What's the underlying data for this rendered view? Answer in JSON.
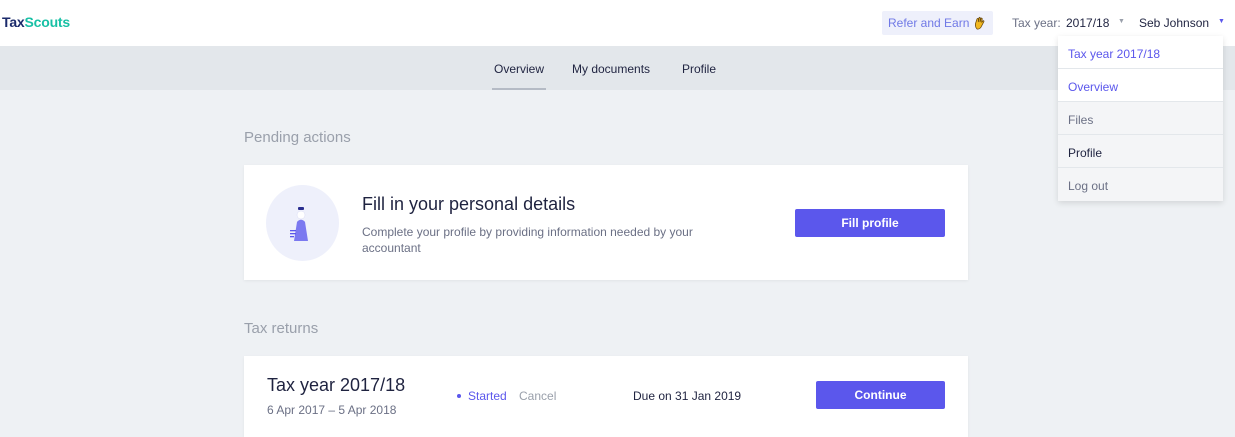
{
  "header": {
    "logo_part1": "Tax",
    "logo_part2": "Scouts",
    "refer_label": "Refer and Earn",
    "tax_year_label": "Tax year:",
    "tax_year_value": "2017/18",
    "user_name": "Seb Johnson"
  },
  "nav": {
    "tabs": [
      {
        "label": "Overview"
      },
      {
        "label": "My documents"
      },
      {
        "label": "Profile"
      }
    ]
  },
  "pending": {
    "section_title": "Pending actions",
    "card_title": "Fill in your personal details",
    "card_desc": "Complete your profile by providing information needed by your accountant",
    "button_label": "Fill profile"
  },
  "tax_returns": {
    "section_title": "Tax returns",
    "item": {
      "title": "Tax year 2017/18",
      "dates": "6 Apr 2017 – 5 Apr 2018",
      "status": "Started",
      "cancel_label": "Cancel",
      "due": "Due on 31 Jan 2019",
      "button_label": "Continue"
    }
  },
  "dropdown": {
    "items": [
      {
        "label": "Tax year 2017/18"
      },
      {
        "label": "Overview"
      },
      {
        "label": "Files"
      },
      {
        "label": "Profile"
      },
      {
        "label": "Log out"
      }
    ]
  },
  "colors": {
    "accent": "#5b57ec",
    "brand_teal": "#18c0a5",
    "brand_navy": "#1b2a6b"
  }
}
